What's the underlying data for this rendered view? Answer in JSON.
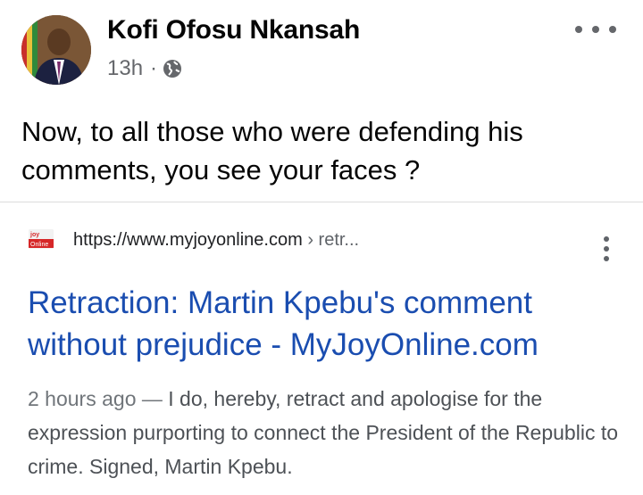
{
  "post": {
    "author": "Kofi Ofosu Nkansah",
    "time": "13h",
    "separator": "·",
    "privacy_icon": "globe-icon",
    "more_icon": "more-horizontal-icon",
    "text": "Now, to all those who were defending his comments, you see your faces ?"
  },
  "search_result": {
    "favicon_icon": "myjoyonline-favicon",
    "url": "https://www.myjoyonline.com",
    "breadcrumb": " › retr...",
    "menu_icon": "more-vertical-icon",
    "title": "Retraction: Martin Kpebu's comment without prejudice - MyJoyOnline.com",
    "age": "2 hours ago",
    "dash": " — ",
    "snippet": "I do, hereby, retract and apologise for the expression purporting to connect the President of the Republic to crime. Signed, Martin Kpebu."
  },
  "colors": {
    "link_title": "#1a4db0",
    "meta_gray": "#65676b",
    "snippet_gray": "#4d5156"
  }
}
